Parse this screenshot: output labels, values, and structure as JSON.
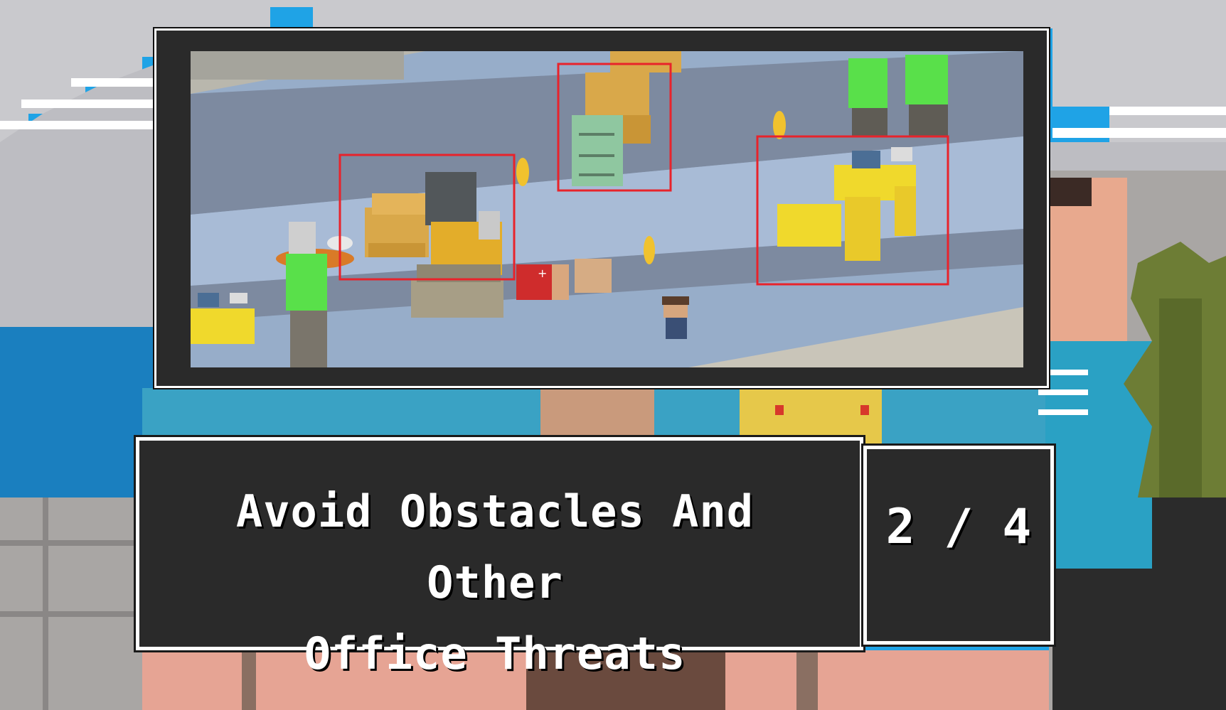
{
  "tutorial": {
    "caption_line1": "Avoid Obstacles And Other",
    "caption_line2": "Office Threats",
    "page_counter": "2 / 4"
  },
  "scene": {
    "highlighted_obstacles": [
      "forklift-with-boxes",
      "filing-cabinet-with-boxes",
      "office-desks"
    ]
  },
  "colors": {
    "panel": "#2a2a2a",
    "panel_border": "#ffffff",
    "highlight": "#e8232b",
    "sky": "#1fa3e6"
  }
}
